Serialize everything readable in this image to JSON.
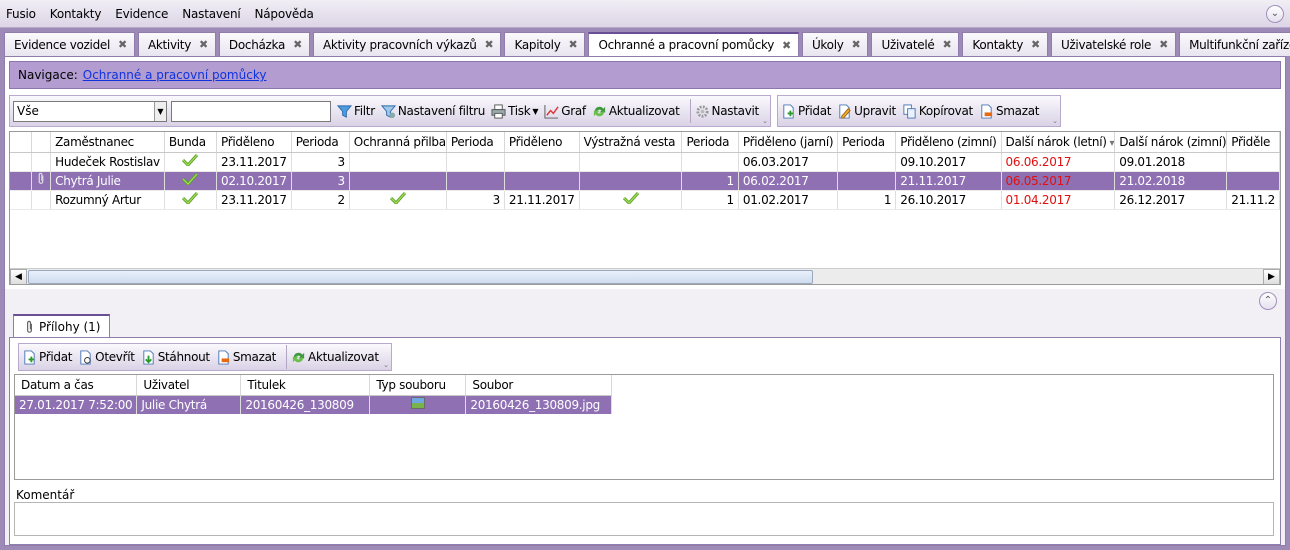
{
  "menu": [
    "Fusio",
    "Kontakty",
    "Evidence",
    "Nastavení",
    "Nápověda"
  ],
  "tabs": [
    {
      "label": "Evidence vozidel",
      "active": false
    },
    {
      "label": "Aktivity",
      "active": false
    },
    {
      "label": "Docházka",
      "active": false
    },
    {
      "label": "Aktivity pracovních výkazů",
      "active": false
    },
    {
      "label": "Kapitoly",
      "active": false
    },
    {
      "label": "Ochranné a pracovní pomůcky",
      "active": true
    },
    {
      "label": "Úkoly",
      "active": false
    },
    {
      "label": "Uživatelé",
      "active": false
    },
    {
      "label": "Kontakty",
      "active": false
    },
    {
      "label": "Uživatelské role",
      "active": false
    },
    {
      "label": "Multifunkční zařízení",
      "active": false
    }
  ],
  "navigation": {
    "label": "Navigace:",
    "link": "Ochranné a pracovní pomůcky"
  },
  "filter": {
    "select_value": "Vše",
    "search_value": ""
  },
  "toolbar": {
    "filtr": "Filtr",
    "nastaveni_filtru": "Nastavení filtru",
    "tisk": "Tisk",
    "graf": "Graf",
    "aktualizovat": "Aktualizovat",
    "nastavit": "Nastavit",
    "pridat": "Přidat",
    "upravit": "Upravit",
    "kopirovat": "Kopírovat",
    "smazat": "Smazat"
  },
  "grid": {
    "columns": [
      "",
      "Zaměstnanec",
      "Bunda",
      "Přiděleno",
      "Perioda",
      "Ochranná přilba",
      "Perioda",
      "Přiděleno",
      "Výstražná vesta",
      "Perioda",
      "Přiděleno (jarní)",
      "Perioda",
      "Přiděleno (zimní)",
      "Další nárok (letní)",
      "Další nárok (zimní)",
      "Přiděle"
    ],
    "rows": [
      {
        "attach": false,
        "selected": false,
        "cells": [
          "Hudeček Rostislav",
          true,
          "23.11.2017",
          "3",
          false,
          "",
          "",
          false,
          "",
          "06.03.2017",
          "",
          "09.10.2017",
          "06.06.2017",
          "09.01.2018",
          ""
        ]
      },
      {
        "attach": true,
        "selected": true,
        "cells": [
          "Chytrá Julie",
          true,
          "02.10.2017",
          "3",
          false,
          "",
          "",
          false,
          "1",
          "06.02.2017",
          "",
          "21.11.2017",
          "06.05.2017",
          "21.02.2018",
          ""
        ]
      },
      {
        "attach": false,
        "selected": false,
        "cells": [
          "Rozumný Artur",
          true,
          "23.11.2017",
          "2",
          true,
          "3",
          "21.11.2017",
          true,
          "1",
          "01.02.2017",
          "1",
          "26.10.2017",
          "01.04.2017",
          "26.12.2017",
          "21.11.2"
        ]
      }
    ]
  },
  "attachments": {
    "tab_label": "Přílohy (1)",
    "toolbar": {
      "pridat": "Přidat",
      "otevrit": "Otevřít",
      "stahnout": "Stáhnout",
      "smazat": "Smazat",
      "aktualizovat": "Aktualizovat"
    },
    "columns": [
      "Datum a čas",
      "Uživatel",
      "Titulek",
      "Typ souboru",
      "Soubor"
    ],
    "rows": [
      {
        "datum": "27.01.2017 7:52:00",
        "uzivatel": "Julie Chytrá",
        "titulek": "20160426_130809",
        "soubor": "20160426_130809.jpg"
      }
    ]
  },
  "comment_label": "Komentář",
  "colors": {
    "accent": "#8e70b3",
    "navbar": "#b29cd0",
    "overdue": "#e01010"
  }
}
